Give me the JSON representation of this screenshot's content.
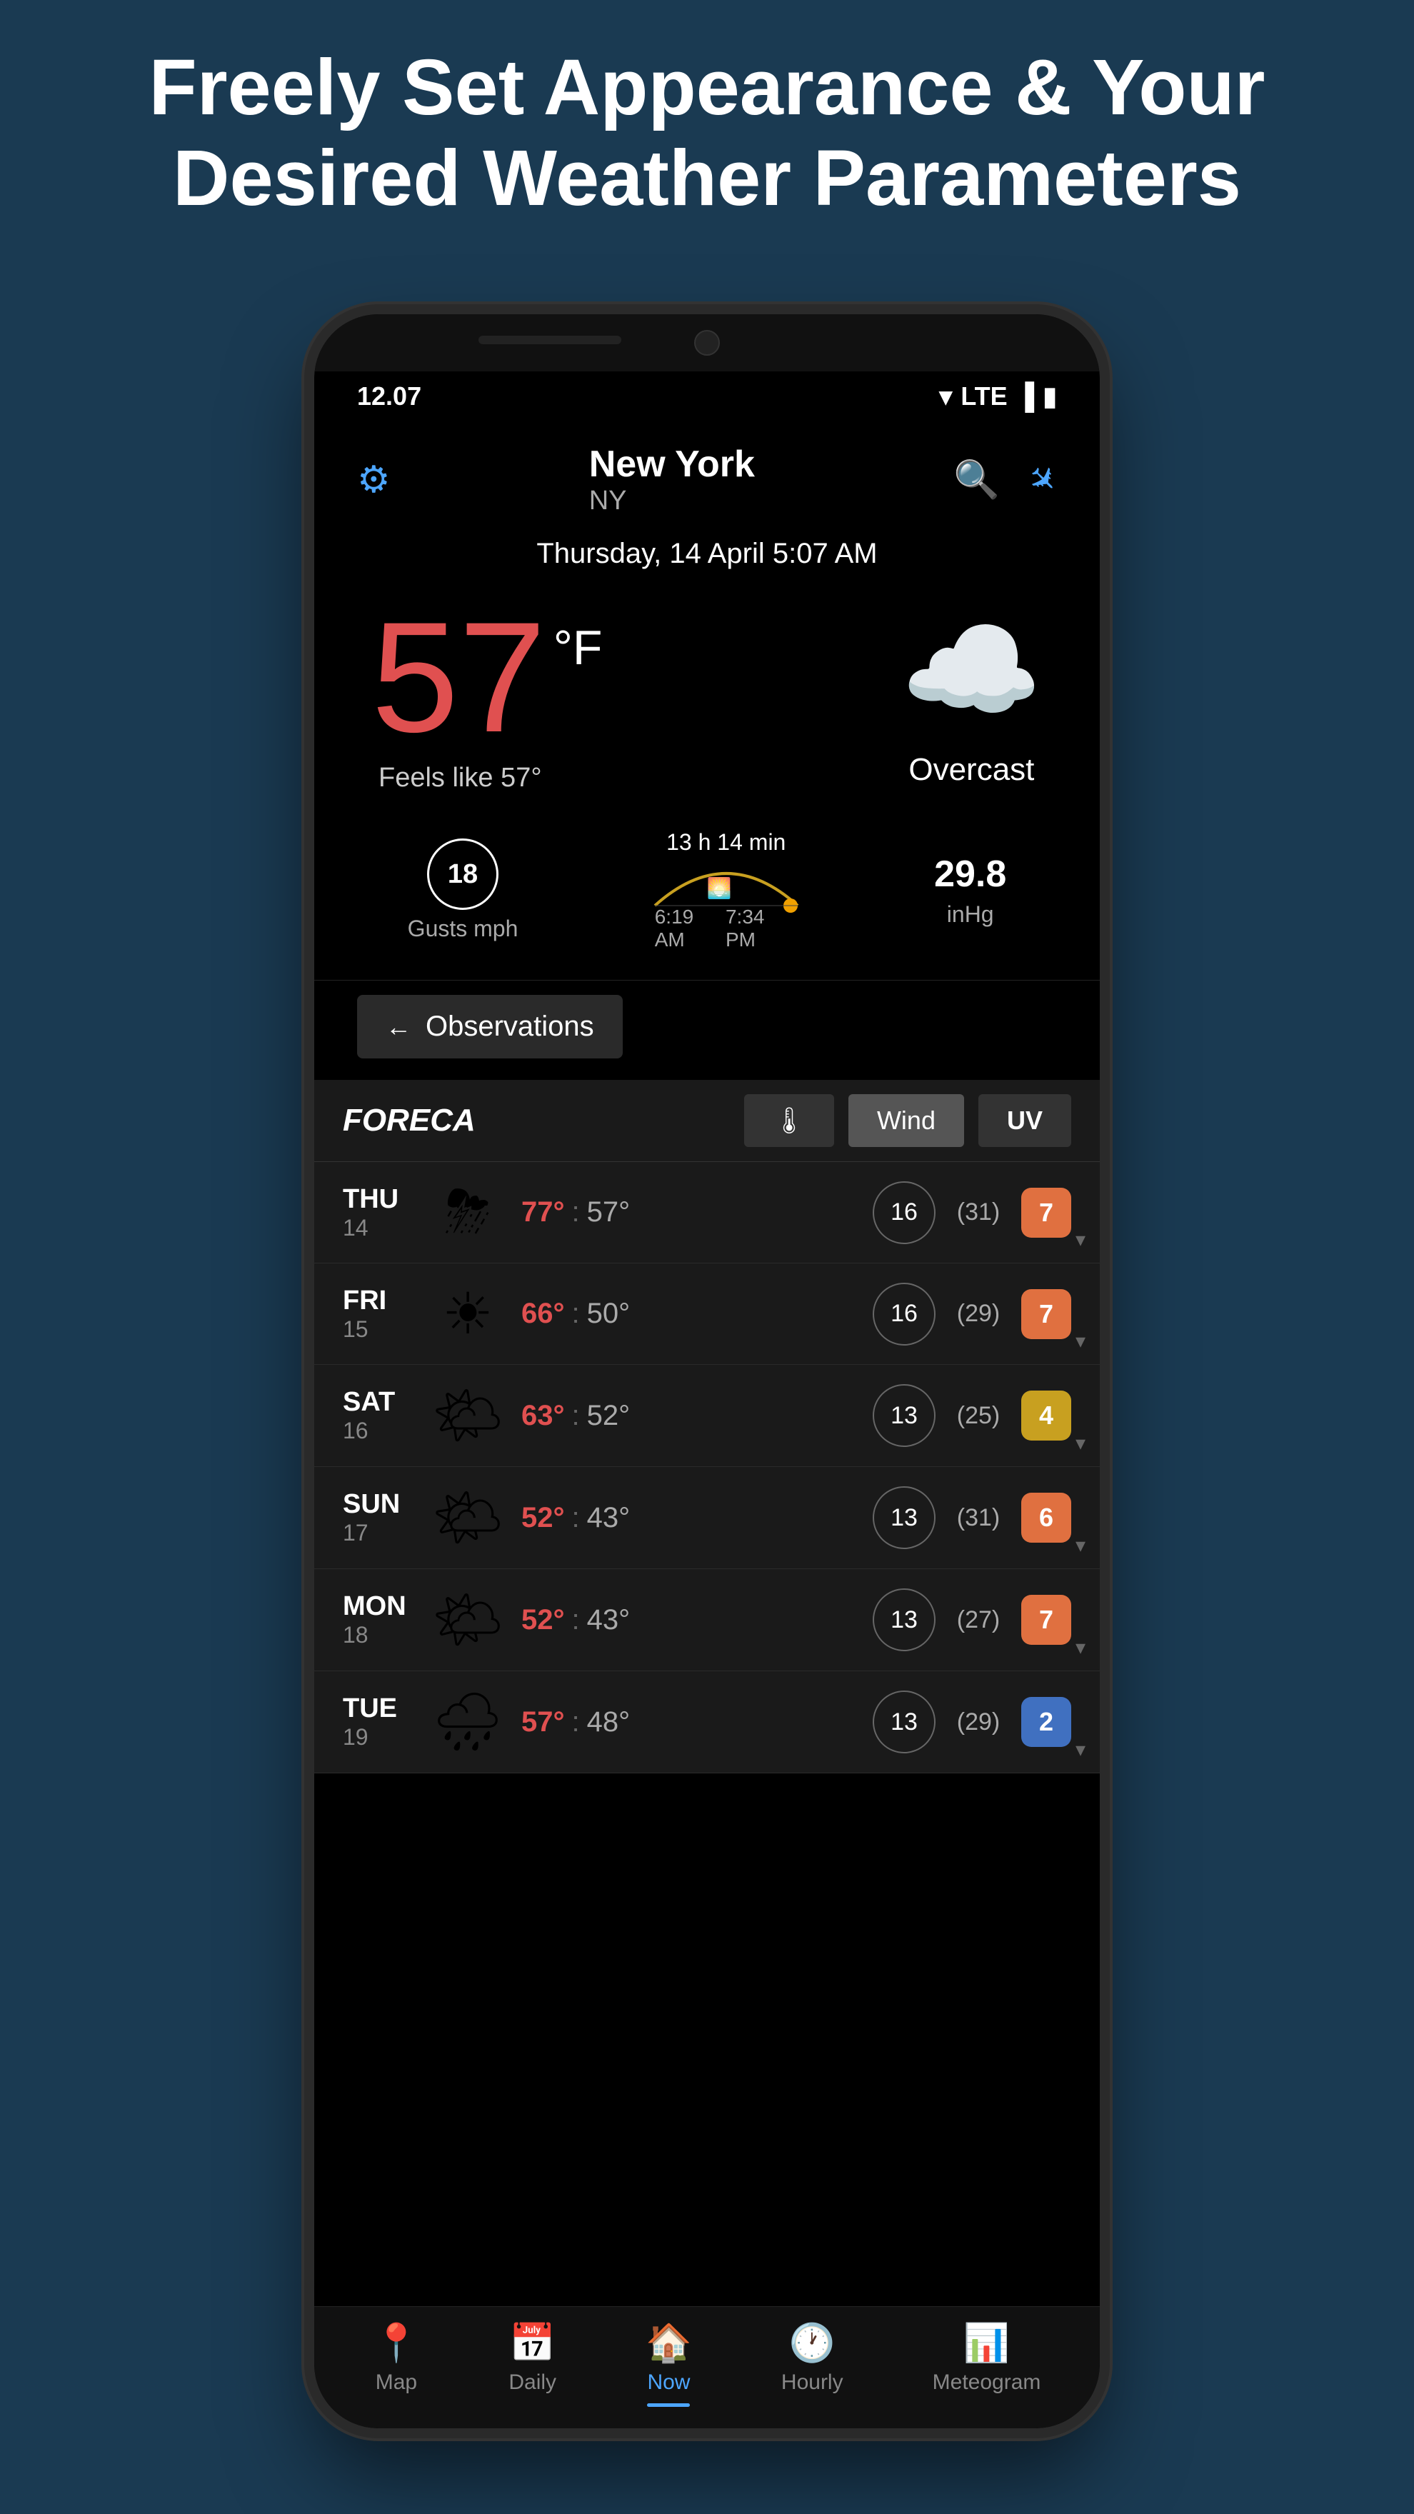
{
  "page": {
    "header_line1": "Freely Set Appearance & Your",
    "header_line2": "Desired Weather Parameters"
  },
  "status_bar": {
    "time": "12.07",
    "lte": "LTE"
  },
  "app_header": {
    "city": "New York",
    "state": "NY",
    "settings_icon": "⚙",
    "search_icon": "🔍",
    "location_icon": "✈"
  },
  "date": "Thursday, 14 April 5:07 AM",
  "current": {
    "temp": "57",
    "unit": "°F",
    "feels_like": "Feels like 57°",
    "weather_icon": "☁",
    "description": "Overcast",
    "gusts_value": "18",
    "gusts_unit": "Gusts mph",
    "sunrise": "6:19 AM",
    "sunset": "7:34 PM",
    "duration": "13 h 14 min",
    "pressure_value": "29.8",
    "pressure_unit": "inHg"
  },
  "observations_btn": "Observations",
  "foreca": {
    "logo": "FORECA",
    "tab_temp": "🌡",
    "tab_wind": "Wind",
    "tab_uv": "UV"
  },
  "forecast": [
    {
      "day": "THU",
      "num": "14",
      "icon": "⛈",
      "high": "77°",
      "low": "57°",
      "wind": "16",
      "wind_val": "(31)",
      "uv": "7",
      "uv_class": "uv-orange"
    },
    {
      "day": "FRI",
      "num": "15",
      "icon": "☀",
      "high": "66°",
      "low": "50°",
      "wind": "16",
      "wind_val": "(29)",
      "uv": "7",
      "uv_class": "uv-orange"
    },
    {
      "day": "SAT",
      "num": "16",
      "icon": "🌤",
      "high": "63°",
      "low": "52°",
      "wind": "13",
      "wind_val": "(25)",
      "uv": "4",
      "uv_class": "uv-yellow"
    },
    {
      "day": "SUN",
      "num": "17",
      "icon": "🌤",
      "high": "52°",
      "low": "43°",
      "wind": "13",
      "wind_val": "(31)",
      "uv": "6",
      "uv_class": "uv-orange"
    },
    {
      "day": "MON",
      "num": "18",
      "icon": "🌤",
      "high": "52°",
      "low": "43°",
      "wind": "13",
      "wind_val": "(27)",
      "uv": "7",
      "uv_class": "uv-orange"
    },
    {
      "day": "TUE",
      "num": "19",
      "icon": "🌧",
      "high": "57°",
      "low": "48°",
      "wind": "13",
      "wind_val": "(29)",
      "uv": "2",
      "uv_class": "uv-blue"
    }
  ],
  "bottom_nav": [
    {
      "icon": "📍",
      "label": "Map",
      "active": false
    },
    {
      "icon": "📅",
      "label": "Daily",
      "active": false
    },
    {
      "icon": "🏠",
      "label": "Now",
      "active": true
    },
    {
      "icon": "🕐",
      "label": "Hourly",
      "active": false
    },
    {
      "icon": "📊",
      "label": "Meteogram",
      "active": false
    }
  ]
}
